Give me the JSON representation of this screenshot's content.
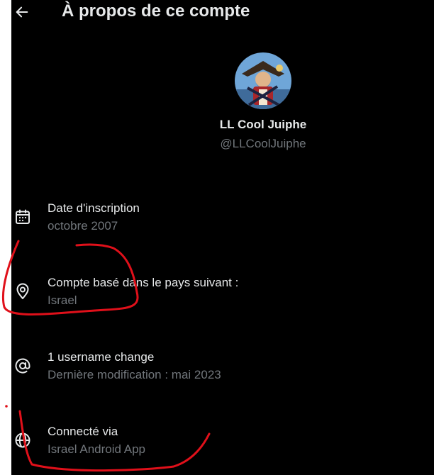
{
  "header": {
    "title": "À propos de ce compte",
    "back_icon": "arrow-left-icon"
  },
  "profile": {
    "display_name": "LL Cool Juiphe",
    "handle": "@LLCoolJuiphe",
    "avatar": "cartoon-pirate-avatar"
  },
  "rows": [
    {
      "icon": "calendar-icon",
      "label": "Date d'inscription",
      "value": "octobre 2007"
    },
    {
      "icon": "location-pin-icon",
      "label": "Compte basé dans le pays suivant :",
      "value": "Israel"
    },
    {
      "icon": "at-sign-icon",
      "label": "1 username change",
      "value": "Dernière modification : mai 2023"
    },
    {
      "icon": "globe-icon",
      "label": "Connecté via",
      "value": "Israel Android App"
    }
  ],
  "colors": {
    "background": "#000000",
    "text_primary": "#e7e9ea",
    "text_secondary": "#71767b",
    "annotation": "#e0101a"
  }
}
